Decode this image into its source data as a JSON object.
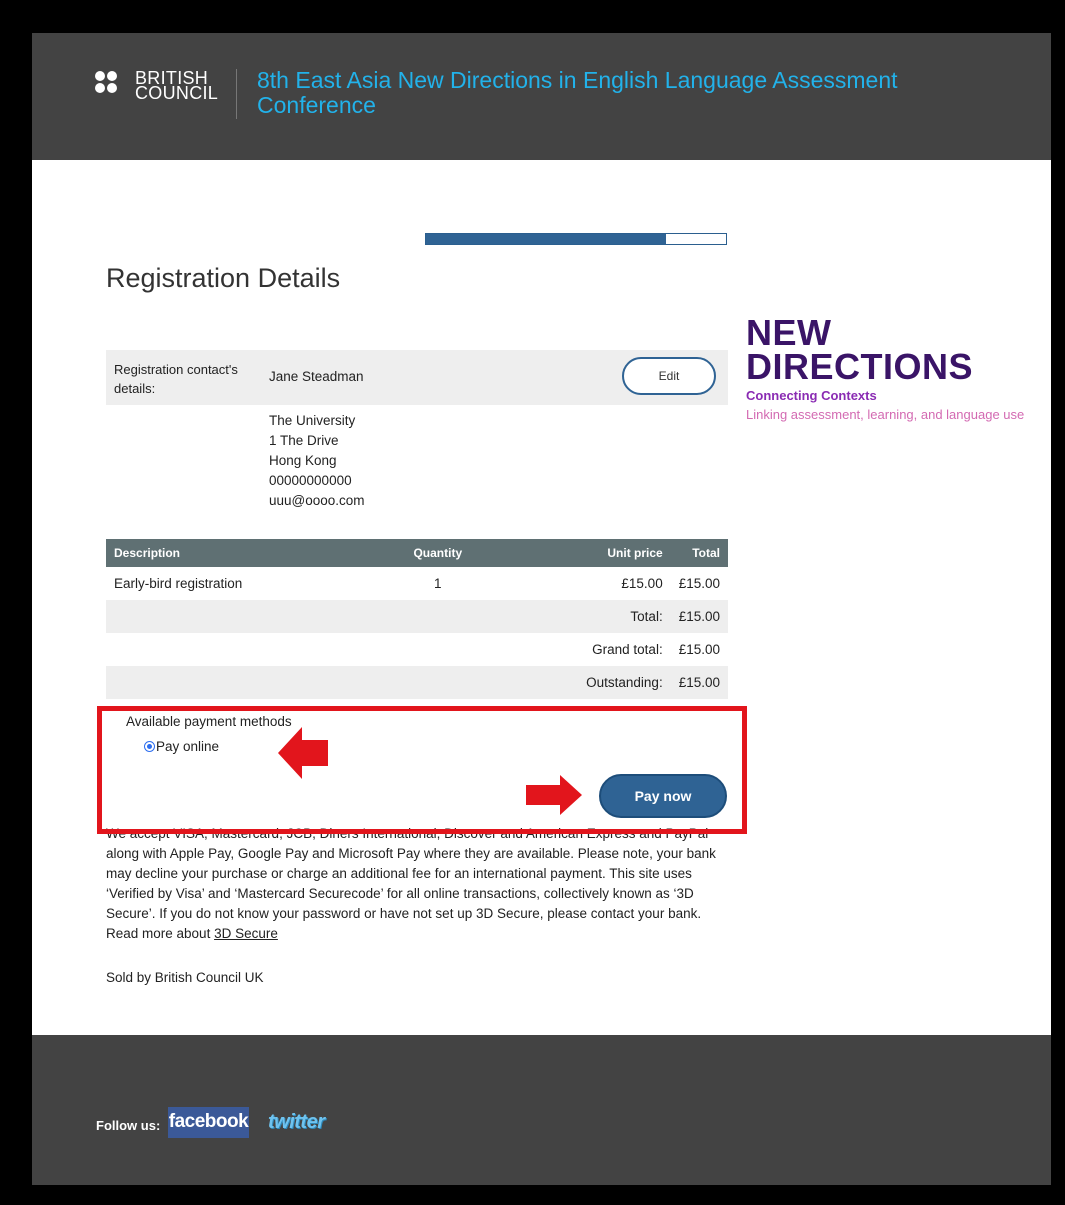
{
  "header": {
    "org_logo_text": "BRITISH COUNCIL",
    "conference_title": "8th East Asia New Directions in English Language Assessment Conference"
  },
  "progress": {
    "fraction": 0.8
  },
  "page_title": "Registration Details",
  "brand": {
    "line1": "NEW",
    "line2": "DIRECTIONS",
    "subtitle": "Connecting Contexts",
    "tagline": "Linking assessment, learning, and language use"
  },
  "contact": {
    "label": "Registration contact's details:",
    "name": "Jane Steadman",
    "edit_label": "Edit",
    "address": [
      "The University",
      "1 The Drive",
      "Hong Kong",
      "00000000000",
      "uuu@oooo.com"
    ]
  },
  "order": {
    "headers": {
      "description": "Description",
      "quantity": "Quantity",
      "unit_price": "Unit price",
      "total": "Total"
    },
    "items": [
      {
        "description": "Early-bird registration",
        "quantity": "1",
        "unit_price": "£15.00",
        "total": "£15.00"
      }
    ],
    "summary": [
      {
        "label": "Total:",
        "value": "£15.00"
      },
      {
        "label": "Grand total:",
        "value": "£15.00"
      },
      {
        "label": "Outstanding:",
        "value": "£15.00"
      }
    ]
  },
  "payment": {
    "methods_label": "Available payment methods",
    "option_label": "Pay online",
    "pay_button": "Pay now"
  },
  "disclaimer": {
    "text": "We accept VISA, Mastercard, JCB, Diners International, Discover and American Express and PayPal along with Apple Pay, Google Pay and Microsoft Pay where they are available. Please note, your bank may decline your purchase or charge an additional fee for an international payment. This site uses ‘Verified by Visa’ and ‘Mastercard Securecode’ for all online transactions, collectively known as ‘3D Secure’. If you do not know your password or have not set up 3D Secure, please contact your bank. Read more about ",
    "link": "3D Secure"
  },
  "sold_by": "Sold by British Council UK",
  "footer": {
    "follow_label": "Follow us:",
    "facebook": "facebook",
    "twitter": "twitter"
  },
  "colors": {
    "accent": "#2f6394",
    "highlight": "#e2151c",
    "header_bg": "#434343",
    "title_blue": "#22b2ea"
  }
}
